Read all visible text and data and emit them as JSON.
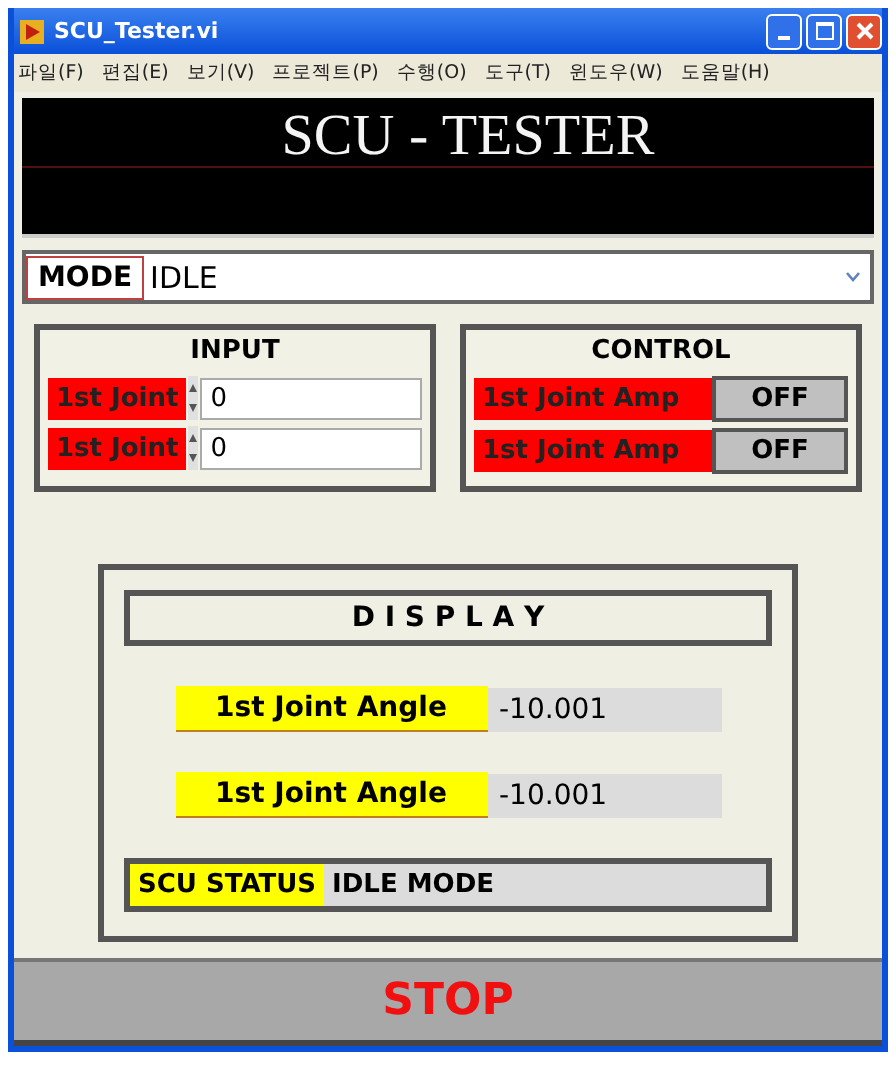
{
  "window": {
    "title": "SCU_Tester.vi"
  },
  "menu": [
    "파일(F)",
    "편집(E)",
    "보기(V)",
    "프로젝트(P)",
    "수행(O)",
    "도구(T)",
    "윈도우(W)",
    "도움말(H)"
  ],
  "banner": {
    "title": "SCU - TESTER"
  },
  "mode": {
    "label": "MODE",
    "value": "IDLE"
  },
  "input": {
    "title": "INPUT",
    "rows": [
      {
        "label": "1st Joint",
        "value": "0"
      },
      {
        "label": "1st Joint",
        "value": "0"
      }
    ]
  },
  "control": {
    "title": "CONTROL",
    "rows": [
      {
        "label": "1st Joint Amp",
        "button": "OFF"
      },
      {
        "label": "1st Joint Amp",
        "button": "OFF"
      }
    ]
  },
  "display": {
    "title": "D I S P L A Y",
    "readings": [
      {
        "label": "1st Joint Angle",
        "value": "-10.001"
      },
      {
        "label": "1st Joint Angle",
        "value": "-10.001"
      }
    ],
    "status": {
      "label": "SCU STATUS",
      "value": "IDLE MODE"
    }
  },
  "stop_button": "STOP"
}
